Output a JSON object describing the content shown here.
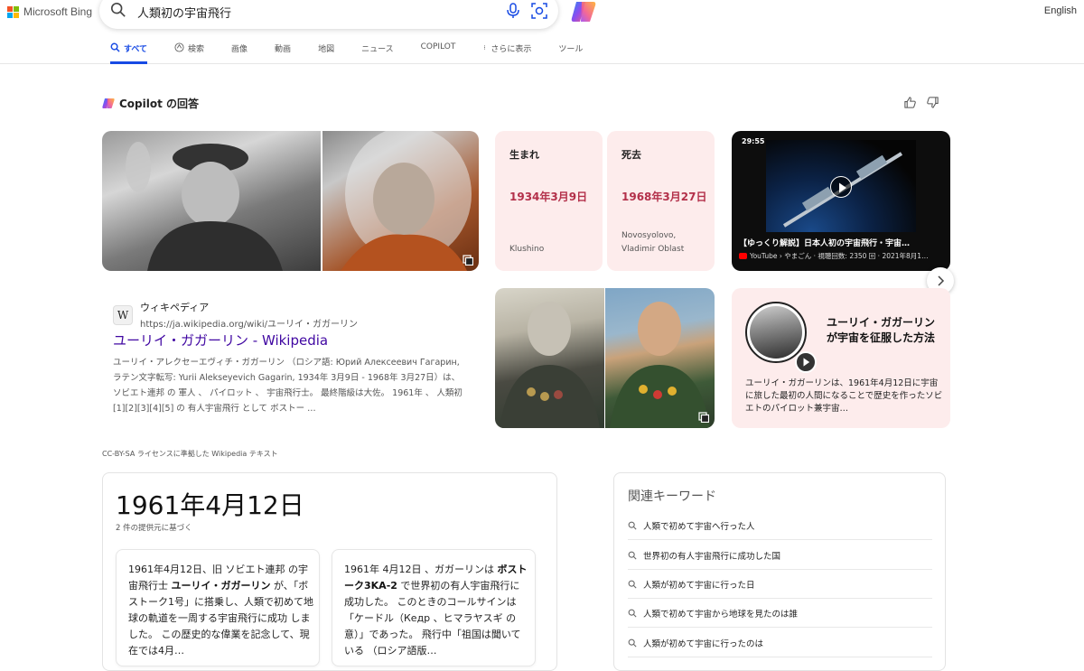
{
  "brand": {
    "name": "Microsoft Bing",
    "colors": [
      "#f35325",
      "#81bc06",
      "#05a6f0",
      "#ffba08"
    ]
  },
  "search": {
    "query": "人類初の宇宙飛行"
  },
  "header": {
    "language": "English"
  },
  "tabs": [
    {
      "label": "すべて",
      "active": true,
      "icon": "search-icon"
    },
    {
      "label": "検索",
      "active": false,
      "icon": "copilot-search-icon"
    },
    {
      "label": "画像",
      "active": false
    },
    {
      "label": "動画",
      "active": false
    },
    {
      "label": "地図",
      "active": false
    },
    {
      "label": "ニュース",
      "active": false
    },
    {
      "label": "COPILOT",
      "active": false
    },
    {
      "label": "さらに表示",
      "active": false,
      "icon": "more-vertical-icon"
    },
    {
      "label": "ツール",
      "active": false
    }
  ],
  "copilot": {
    "title": "Copilot の回答"
  },
  "facts": {
    "born": {
      "label": "生まれ",
      "date": "1934年3月9日",
      "place": "Klushino"
    },
    "died": {
      "label": "死去",
      "date": "1968年3月27日",
      "place": "Novosyolovo, Vladimir Oblast"
    }
  },
  "video": {
    "duration": "29:55",
    "title": "【ゆっくり解説】日本人初の宇宙飛行・宇宙…",
    "meta": "YouTube › やまごん · 視聴回数: 2350 回 · 2021年8月1…"
  },
  "yuri_card": {
    "title": "ユーリイ・ガガーリンが宇宙を征服した方法",
    "description": "ユーリイ・ガガーリンは、1961年4月12日に宇宙に旅した最初の人間になることで歴史を作ったソビエトのパイロット兼宇宙…"
  },
  "wiki": {
    "source_name": "ウィキペディア",
    "url": "https://ja.wikipedia.org/wiki/ユーリイ・ガガーリン",
    "title": "ユーリイ・ガガーリン - Wikipedia",
    "snippet": "ユーリイ・アレクセーエヴィチ・ガガーリン （ロシア語: Юрий Алексеевич Гагарин, ラテン文字転写: Yurii Alekseyevich Gagarin, 1934年 3月9日 - 1968年 3月27日）は、 ソビエト連邦 の 軍人 、 パイロット 、 宇宙飛行士。 最終階級は大佐。 1961年 、 人類初 [1][2][3][4][5] の 有人宇宙飛行 として ボストー …"
  },
  "license": "CC-BY-SA ライセンスに準拠した Wikipedia テキスト",
  "answer": {
    "date": "1961年4月12日",
    "providers": "2 件の提供元に基づく",
    "sources": [
      {
        "pre": "1961年4月12日、旧 ソビエト連邦 の宇宙飛行士 ",
        "bold": "ユーリイ・ガガーリン",
        "post": " が、「ボストーク1号」に搭乗し、人類で初めて地球の軌道を一周する宇宙飛行に成功 しました。 この歴史的な偉業を記念して、現在では4月…"
      },
      {
        "pre": "1961年 4月12日 、ガガーリンは ",
        "bold": "ボストーク3KA-2",
        "post": " で世界初の有人宇宙飛行に成功した。 このときのコールサインは「ケードル（Кедр 、ヒマラヤスギ の意）」であった。 飛行中「祖国は聞いている （ロシア語版…"
      }
    ]
  },
  "related": {
    "title": "関連キーワード",
    "items": [
      "人類で初めて宇宙へ行った人",
      "世界初の有人宇宙飛行に成功した国",
      "人類が初めて宇宙に行った日",
      "人類で初めて宇宙から地球を見たのは誰",
      "人類が初めて宇宙に行ったのは"
    ]
  }
}
